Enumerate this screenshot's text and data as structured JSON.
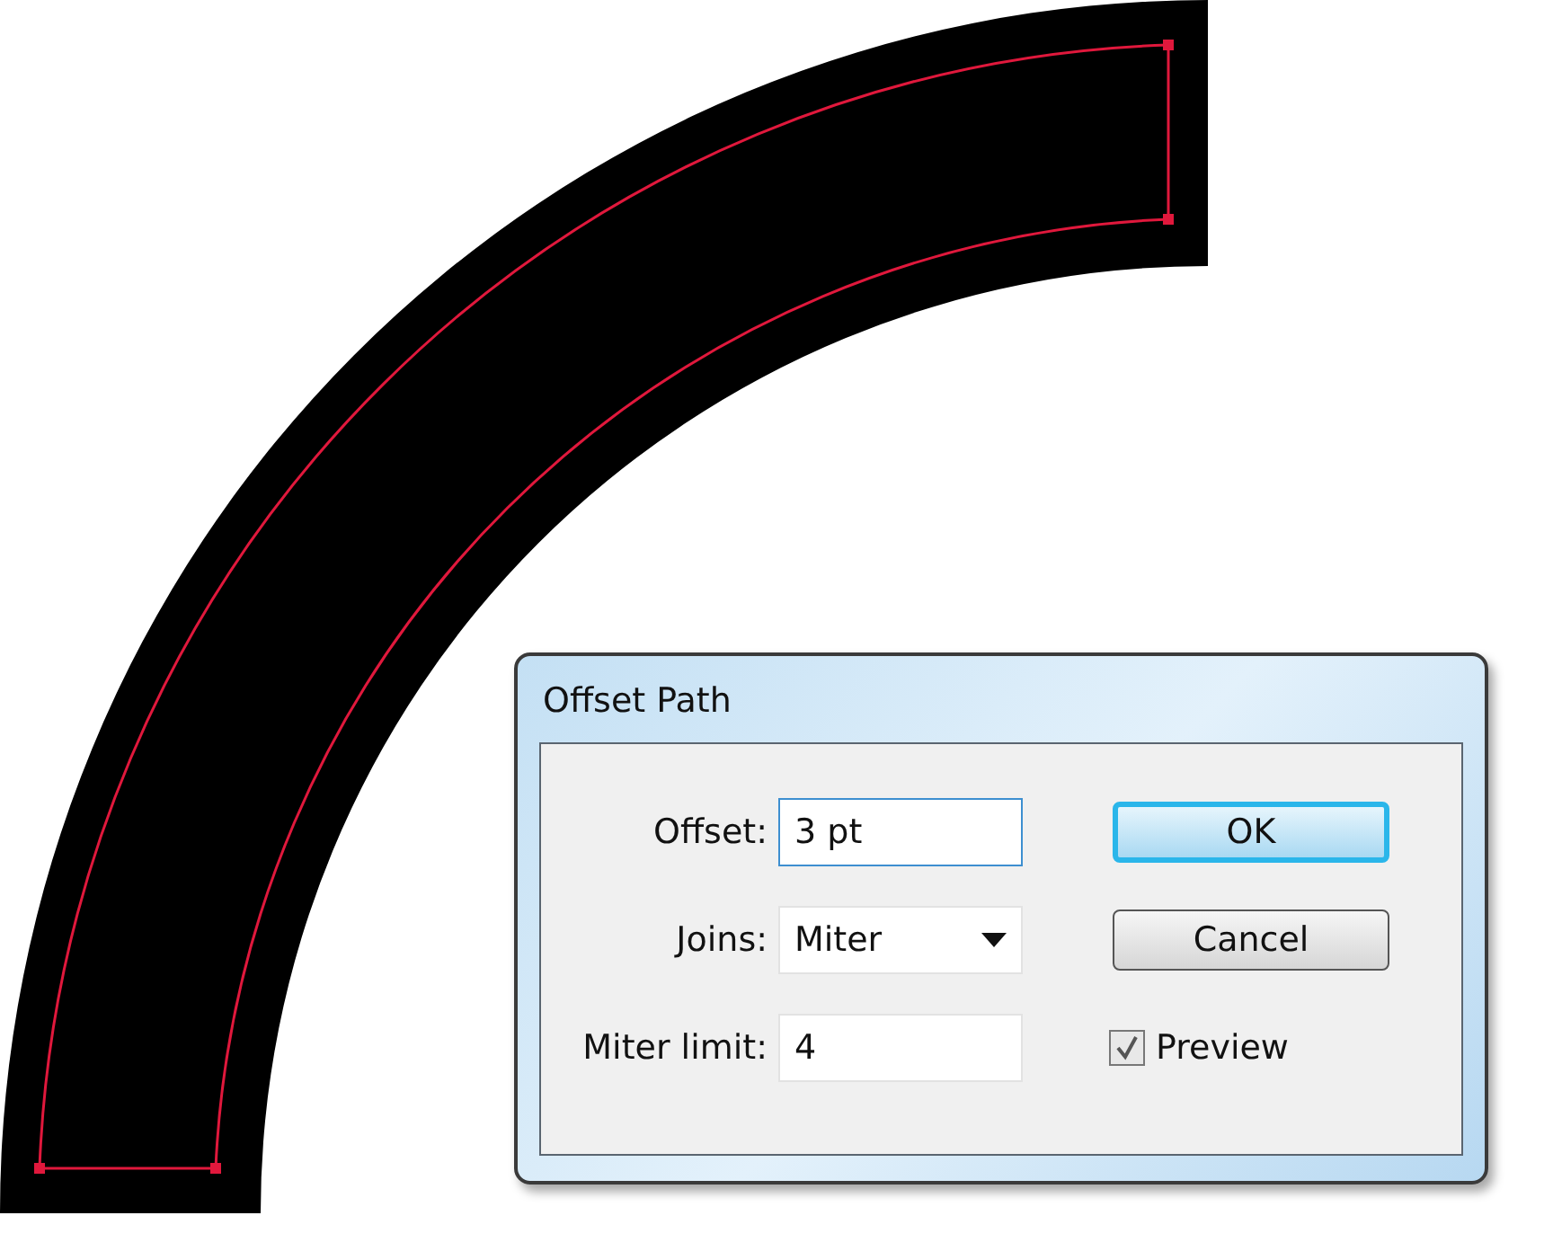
{
  "dialog": {
    "title": "Offset Path",
    "fields": [
      {
        "kind": "text",
        "label": "Offset:",
        "value": "3 pt",
        "focused": true
      },
      {
        "kind": "dropdown",
        "label": "Joins:",
        "value": "Miter",
        "focused": false
      },
      {
        "kind": "text",
        "label": "Miter limit:",
        "value": "4",
        "focused": false
      }
    ],
    "buttons": [
      {
        "label": "OK",
        "default": true
      },
      {
        "label": "Cancel",
        "default": false
      }
    ],
    "preview": {
      "label": "Preview",
      "checked": true
    }
  }
}
